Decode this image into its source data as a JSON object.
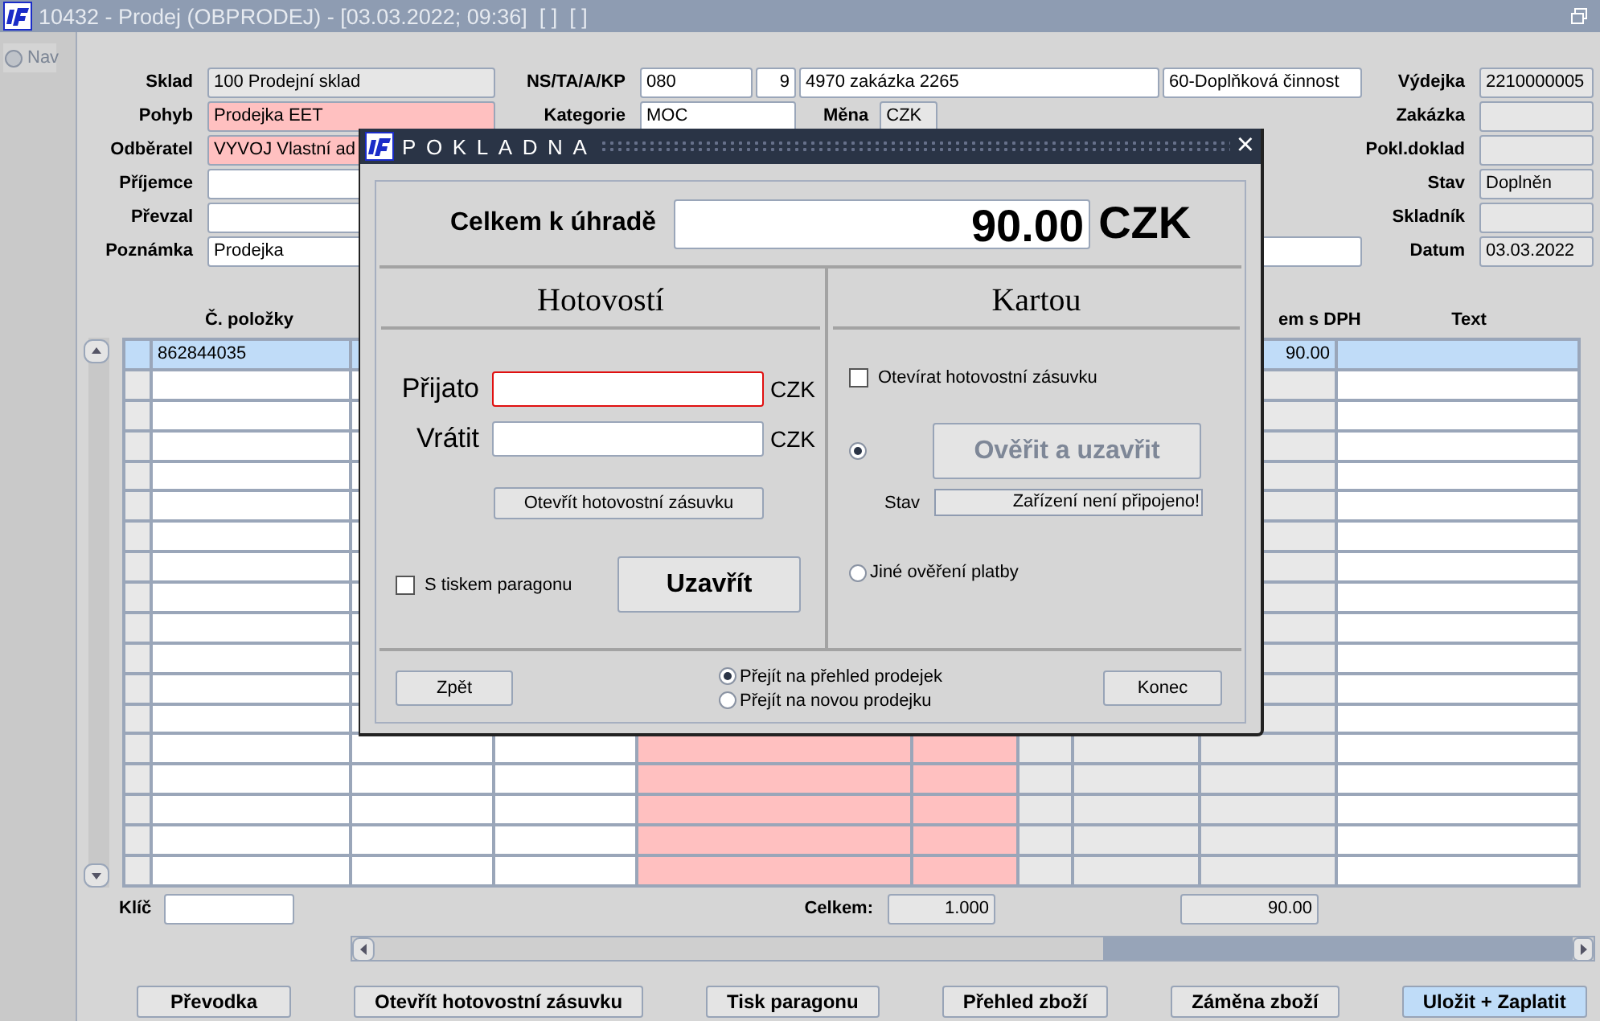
{
  "window": {
    "title": "10432 - Prodej (OBPRODEJ) - [03.03.2022; 09:36]  [ ]  [ ]"
  },
  "nav": {
    "label": "Nav",
    "selected": false
  },
  "form_left": [
    {
      "label": "Sklad",
      "value": "100 Prodejní sklad",
      "kind": "readonly"
    },
    {
      "label": "Pohyb",
      "value": "Prodejka EET",
      "kind": "required"
    },
    {
      "label": "Odběratel",
      "value": "VYVOJ Vlastní ad",
      "kind": "required"
    },
    {
      "label": "Příjemce",
      "kind": "input"
    },
    {
      "label": "Převzal",
      "kind": "input"
    },
    {
      "label": "Poznámka",
      "value": "Prodejka",
      "kind": "input"
    }
  ],
  "form_middle": [
    {
      "label": "NS/TA/A/KP",
      "fields": [
        {
          "value": "080",
          "kind": "input"
        },
        {
          "value": "9",
          "kind": "input"
        },
        {
          "value": "4970 zakázka 2265",
          "kind": "input"
        },
        {
          "value": "60-Doplňková činnost",
          "kind": "input"
        }
      ]
    },
    {
      "label": "Kategorie",
      "fields": [
        {
          "value": "MOC",
          "kind": "input"
        },
        {
          "label": "Měna"
        },
        {
          "value": "CZK",
          "kind": "readonly"
        }
      ]
    }
  ],
  "form_right": [
    {
      "label": "Výdejka",
      "value": "2210000005",
      "kind": "readonly"
    },
    {
      "label": "Zakázka",
      "kind": "readonly"
    },
    {
      "label": "Pokl.doklad",
      "kind": "readonly"
    },
    {
      "label": "Stav",
      "value": "Doplněn",
      "kind": "readonly"
    },
    {
      "label": "Skladník",
      "kind": "readonly"
    },
    {
      "label": "Datum",
      "value": "03.03.2022",
      "kind": "readonly"
    }
  ],
  "table": {
    "columns": [
      {
        "header": "Č. položky",
        "kind": "input"
      },
      {
        "kind": "input"
      },
      {
        "kind": "input"
      },
      {
        "kind": "required"
      },
      {
        "kind": "required"
      },
      {
        "kind": "readonly"
      },
      {
        "kind": "readonly"
      },
      {
        "header": "em s DPH",
        "kind": "readonly"
      },
      {
        "header": "Text",
        "kind": "input"
      }
    ],
    "rows": [
      {
        "selected": true,
        "cells": [
          "862844035",
          null,
          null,
          null,
          null,
          null,
          null,
          "90.00",
          null
        ]
      },
      {
        "selected": false
      },
      {
        "selected": false
      },
      {
        "selected": false
      },
      {
        "selected": false
      },
      {
        "selected": false
      },
      {
        "selected": false
      },
      {
        "selected": false
      },
      {
        "selected": false
      },
      {
        "selected": false
      },
      {
        "selected": false
      },
      {
        "selected": false
      },
      {
        "selected": false
      },
      {
        "selected": false
      },
      {
        "selected": false
      },
      {
        "selected": false
      },
      {
        "selected": false
      },
      {
        "selected": false
      }
    ]
  },
  "key_field": {
    "label": "Klíč"
  },
  "totals": {
    "label": "Celkem:",
    "quantity": "1.000",
    "amount": "90.00"
  },
  "buttons": [
    {
      "label": "Převodka",
      "selected": false
    },
    {
      "label": "Otevřít hotovostní zásuvku",
      "selected": false
    },
    {
      "label": "Tisk paragonu",
      "selected": false
    },
    {
      "label": "Přehled zboží",
      "selected": false
    },
    {
      "label": "Záměna zboží",
      "selected": false
    },
    {
      "label": "Uložit + Zaplatit",
      "selected": true
    }
  ],
  "dialog": {
    "title": "POKLADNA",
    "close": "×",
    "total": {
      "label": "Celkem k úhradě",
      "value": "90.00",
      "currency": "CZK"
    },
    "cash": {
      "title": "Hotovostí",
      "fields": [
        {
          "label": "Přijato",
          "currency": "CZK",
          "error": true
        },
        {
          "label": "Vrátit",
          "currency": "CZK",
          "error": false
        }
      ],
      "drawer_button": "Otevřít hotovostní zásuvku",
      "print_receipt": {
        "label": "S tiskem paragonu",
        "checked": false
      },
      "close_button": "Uzavřít"
    },
    "card": {
      "title": "Kartou",
      "open_drawer": {
        "label": "Otevírat hotovostní zásuvku",
        "checked": false
      },
      "options": [
        {
          "kind": "terminal",
          "selected": true,
          "button": {
            "label": "Ověřit a uzavřit",
            "disabled": true
          },
          "status_label": "Stav",
          "status": "Zařízení není připojeno!"
        },
        {
          "kind": "other",
          "selected": false,
          "label": "Jiné ověření platby"
        }
      ]
    },
    "back_button": "Zpět",
    "after": [
      {
        "label": "Přejít na přehled prodejek",
        "selected": true
      },
      {
        "label": "Přejít na novou prodejku",
        "selected": false
      }
    ],
    "end_button": "Konec"
  }
}
